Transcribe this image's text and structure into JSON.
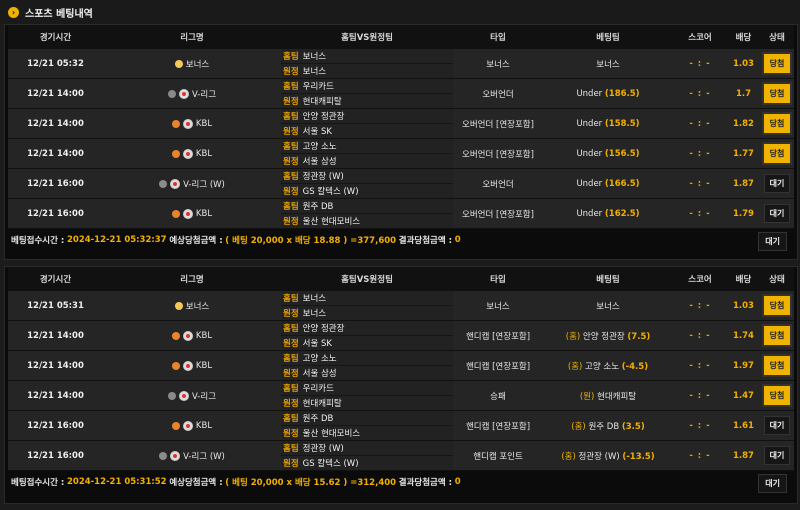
{
  "header": {
    "title": "스포츠 베팅내역"
  },
  "columns": [
    "경기시간",
    "리그명",
    "홈팀VS원정팀",
    "타입",
    "베팅팀",
    "스코어",
    "배당",
    "상태"
  ],
  "labels": {
    "home": "홈팀",
    "away": "원정"
  },
  "panels": [
    {
      "rows": [
        {
          "time": "12/21 05:32",
          "league": "보너스",
          "league_icon": "bonus",
          "home": "보너스",
          "away": "보너스",
          "type": "보너스",
          "pick": "보너스",
          "score": "- : -",
          "odds": "1.03",
          "status": "당첨"
        },
        {
          "time": "12/21 14:00",
          "league": "V-리그",
          "league_icon": "volleyball",
          "home": "우리카드",
          "away": "현대캐피탈",
          "type": "오버언더",
          "pick": "Under",
          "pick_line": "(186.5)",
          "score": "- : -",
          "odds": "1.7",
          "status": "당첨"
        },
        {
          "time": "12/21 14:00",
          "league": "KBL",
          "league_icon": "basketball",
          "home": "안양 정관장",
          "away": "서울 SK",
          "type": "오버언더 [연장포함]",
          "pick": "Under",
          "pick_line": "(158.5)",
          "score": "- : -",
          "odds": "1.82",
          "status": "당첨"
        },
        {
          "time": "12/21 14:00",
          "league": "KBL",
          "league_icon": "basketball",
          "home": "고양 소노",
          "away": "서울 삼성",
          "type": "오버언더 [연장포함]",
          "pick": "Under",
          "pick_line": "(156.5)",
          "score": "- : -",
          "odds": "1.77",
          "status": "당첨"
        },
        {
          "time": "12/21 16:00",
          "league": "V-리그 (W)",
          "league_icon": "volleyball",
          "home": "정관장 (W)",
          "away": "GS 칼텍스 (W)",
          "type": "오버언더",
          "pick": "Under",
          "pick_line": "(166.5)",
          "score": "- : -",
          "odds": "1.87",
          "status": "대기"
        },
        {
          "time": "12/21 16:00",
          "league": "KBL",
          "league_icon": "basketball",
          "home": "원주 DB",
          "away": "울산 현대모비스",
          "type": "오버언더 [연장포함]",
          "pick": "Under",
          "pick_line": "(162.5)",
          "score": "- : -",
          "odds": "1.79",
          "status": "대기"
        }
      ],
      "footer": {
        "label": "베팅접수시간 :",
        "datetime": "2024-12-21 05:32:37",
        "expected_label": "예상당첨금액 :",
        "expected": "( 베팅 20,000 x 배당 18.88 ) =377,600",
        "result_label": "결과당첨금액 :",
        "result": "0",
        "status": "대기"
      }
    },
    {
      "rows": [
        {
          "time": "12/21 05:31",
          "league": "보너스",
          "league_icon": "bonus",
          "home": "보너스",
          "away": "보너스",
          "type": "보너스",
          "pick": "보너스",
          "score": "- : -",
          "odds": "1.03",
          "status": "당첨"
        },
        {
          "time": "12/21 14:00",
          "league": "KBL",
          "league_icon": "basketball",
          "home": "안양 정관장",
          "away": "서울 SK",
          "type": "핸디캡 [연장포함]",
          "pick_mark": "(홈)",
          "pick": "안양 정관장",
          "pick_line": "(7.5)",
          "score": "- : -",
          "odds": "1.74",
          "status": "당첨"
        },
        {
          "time": "12/21 14:00",
          "league": "KBL",
          "league_icon": "basketball",
          "home": "고양 소노",
          "away": "서울 삼성",
          "type": "핸디캡 [연장포함]",
          "pick_mark": "(홈)",
          "pick": "고양 소노",
          "pick_line": "(-4.5)",
          "score": "- : -",
          "odds": "1.97",
          "status": "당첨"
        },
        {
          "time": "12/21 14:00",
          "league": "V-리그",
          "league_icon": "volleyball",
          "home": "우리카드",
          "away": "현대캐피탈",
          "type": "승패",
          "pick_mark": "(원)",
          "pick": "현대캐피탈",
          "pick_line": "",
          "score": "- : -",
          "odds": "1.47",
          "status": "당첨"
        },
        {
          "time": "12/21 16:00",
          "league": "KBL",
          "league_icon": "basketball",
          "home": "원주 DB",
          "away": "울산 현대모비스",
          "type": "핸디캡 [연장포함]",
          "pick_mark": "(홈)",
          "pick": "원주 DB",
          "pick_line": "(3.5)",
          "score": "- : -",
          "odds": "1.61",
          "status": "대기"
        },
        {
          "time": "12/21 16:00",
          "league": "V-리그 (W)",
          "league_icon": "volleyball",
          "home": "정관장 (W)",
          "away": "GS 칼텍스 (W)",
          "type": "핸디캡 포인트",
          "pick_mark": "(홈)",
          "pick": "정관장 (W)",
          "pick_line": "(-13.5)",
          "score": "- : -",
          "odds": "1.87",
          "status": "대기"
        }
      ],
      "footer": {
        "label": "베팅접수시간 :",
        "datetime": "2024-12-21 05:31:52",
        "expected_label": "예상당첨금액 :",
        "expected": "( 베팅 20,000 x 배당 15.62 ) =312,400",
        "result_label": "결과당첨금액 :",
        "result": "0",
        "status": "대기"
      }
    }
  ],
  "colors": {
    "accent": "#f0b400",
    "background": "#1c1c1c",
    "row": "#252525"
  }
}
